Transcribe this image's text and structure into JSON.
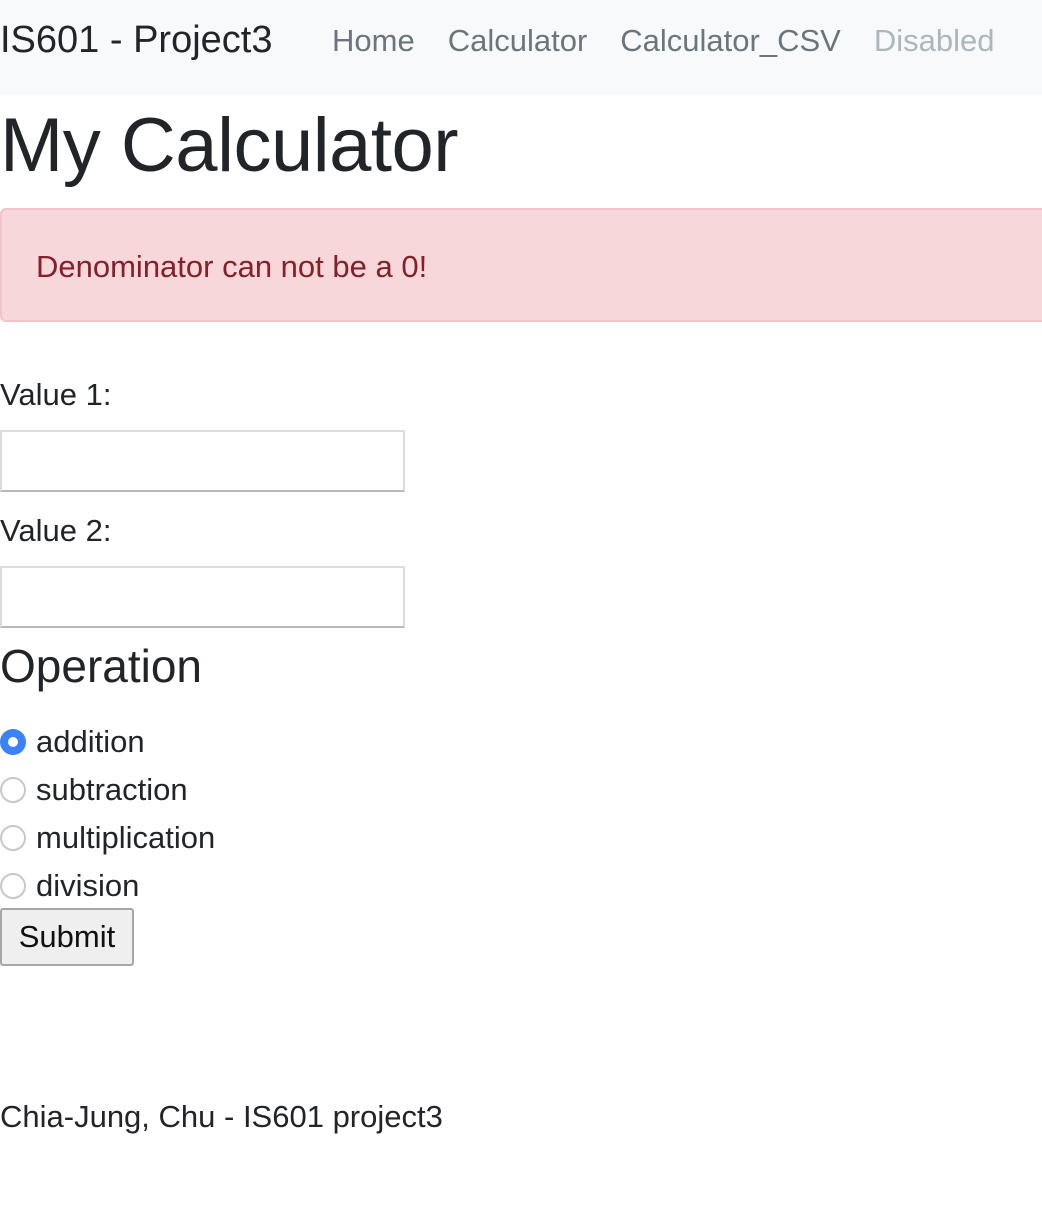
{
  "navbar": {
    "brand": "IS601 - Project3",
    "links": [
      {
        "label": "Home",
        "disabled": false
      },
      {
        "label": "Calculator",
        "disabled": false
      },
      {
        "label": "Calculator_CSV",
        "disabled": false
      },
      {
        "label": "Disabled",
        "disabled": true
      }
    ]
  },
  "page": {
    "title": "My Calculator"
  },
  "alert": {
    "message": "Denominator can not be a 0!"
  },
  "form": {
    "value1_label": "Value 1:",
    "value1_value": "",
    "value2_label": "Value 2:",
    "value2_value": "",
    "operation_heading": "Operation",
    "operations": [
      {
        "label": "addition",
        "checked": true
      },
      {
        "label": "subtraction",
        "checked": false
      },
      {
        "label": "multiplication",
        "checked": false
      },
      {
        "label": "division",
        "checked": false
      }
    ],
    "selected_operation": "addition",
    "submit_label": "Submit"
  },
  "footer": {
    "text": "Chia-Jung, Chu - IS601 project3"
  },
  "colors": {
    "navbar_bg": "#f8f9fa",
    "alert_bg": "#f8d7da",
    "alert_text": "#842029",
    "radio_checked": "#3b82f6"
  }
}
